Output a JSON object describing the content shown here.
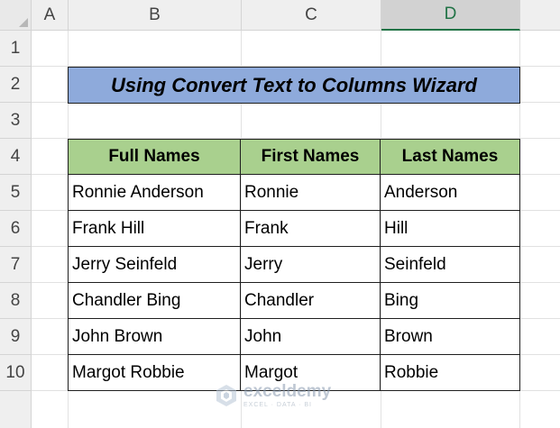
{
  "columns": [
    "A",
    "B",
    "C",
    "D"
  ],
  "selected_column": "D",
  "rows": [
    "1",
    "2",
    "3",
    "4",
    "5",
    "6",
    "7",
    "8",
    "9",
    "10"
  ],
  "title": "Using Convert Text to Columns Wizard",
  "table": {
    "headers": [
      "Full Names",
      "First Names",
      "Last Names"
    ],
    "rows": [
      [
        "Ronnie Anderson",
        "Ronnie",
        "Anderson"
      ],
      [
        "Frank Hill",
        "Frank",
        "Hill"
      ],
      [
        "Jerry Seinfeld",
        "Jerry",
        "Seinfeld"
      ],
      [
        "Chandler Bing",
        "Chandler",
        "Bing"
      ],
      [
        "John Brown",
        "John",
        "Brown"
      ],
      [
        "Margot Robbie",
        "Margot",
        "Robbie"
      ]
    ]
  },
  "watermark": {
    "name": "exceldemy",
    "tagline": "EXCEL · DATA · BI",
    "icon": "exceldemy-logo-icon"
  },
  "colors": {
    "title_fill": "#8eaadb",
    "header_fill": "#a9d08e",
    "selected_col_accent": "#217346"
  }
}
